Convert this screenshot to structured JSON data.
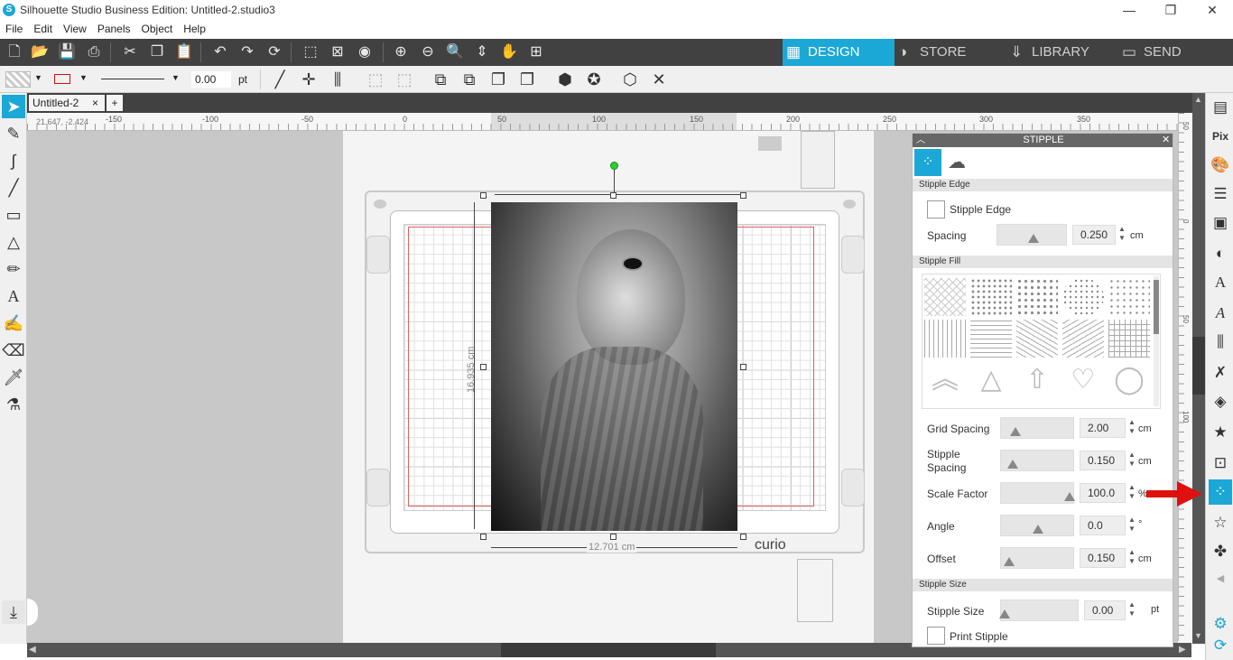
{
  "window": {
    "title": "Silhouette Studio Business Edition: Untitled-2.studio3",
    "logo": "S"
  },
  "menu": [
    "File",
    "Edit",
    "View",
    "Panels",
    "Object",
    "Help"
  ],
  "nav_tabs": {
    "design": "DESIGN",
    "store": "STORE",
    "library": "LIBRARY",
    "send": "SEND"
  },
  "toolbar2": {
    "line_weight": "0.00",
    "unit": "pt"
  },
  "doc_tab": {
    "name": "Untitled-2",
    "close": "×",
    "add": "+"
  },
  "ruler": {
    "coords": "21.647, -2.424",
    "h_ticks": [
      "-150",
      "-100",
      "-50",
      "0",
      "50",
      "100",
      "150",
      "200",
      "250",
      "300",
      "350"
    ],
    "v_ticks": [
      "50",
      "0",
      "50",
      "100"
    ]
  },
  "canvas": {
    "width_dim": "12.701 cm",
    "height_dim": "16.935 cm",
    "mat_brand": "curio"
  },
  "stipple_panel": {
    "title": "STIPPLE",
    "edge_section": "Stipple Edge",
    "edge_checkbox": "Stipple Edge",
    "spacing_label": "Spacing",
    "spacing_value": "0.250",
    "spacing_unit": "cm",
    "fill_section": "Stipple Fill",
    "grid_spacing_label": "Grid Spacing",
    "grid_spacing_value": "2.00",
    "grid_spacing_unit": "cm",
    "stipple_spacing_label": "Stipple Spacing",
    "stipple_spacing_value": "0.150",
    "stipple_spacing_unit": "cm",
    "scale_factor_label": "Scale Factor",
    "scale_factor_value": "100.0",
    "scale_factor_unit": "%",
    "angle_label": "Angle",
    "angle_value": "0.0",
    "angle_unit": "°",
    "offset_label": "Offset",
    "offset_value": "0.150",
    "offset_unit": "cm",
    "size_section": "Stipple Size",
    "size_label": "Stipple Size",
    "size_value": "0.00",
    "size_unit": "pt",
    "print_checkbox": "Print Stipple",
    "sliders": {
      "spacing": 0.55,
      "grid_spacing": 0.2,
      "stipple_spacing": 0.15,
      "scale_factor": 0.97,
      "angle": 0.5,
      "offset": 0.12,
      "size": 0.05
    }
  },
  "colors": {
    "accent": "#1ba8d6",
    "toolbar_dark": "#414141",
    "arrow": "#e01010"
  }
}
